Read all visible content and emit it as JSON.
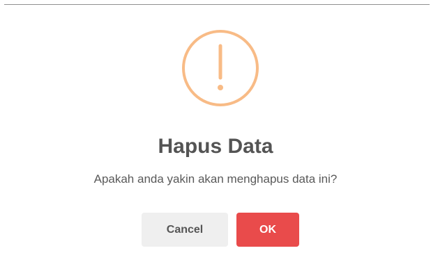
{
  "dialog": {
    "icon": "warning-exclamation-icon",
    "icon_color": "#f8bb86",
    "title": "Hapus Data",
    "message": "Apakah anda yakin akan menghapus data ini?",
    "buttons": {
      "cancel_label": "Cancel",
      "ok_label": "OK"
    },
    "colors": {
      "ok_button": "#e94b4b",
      "cancel_button": "#efefef"
    }
  }
}
